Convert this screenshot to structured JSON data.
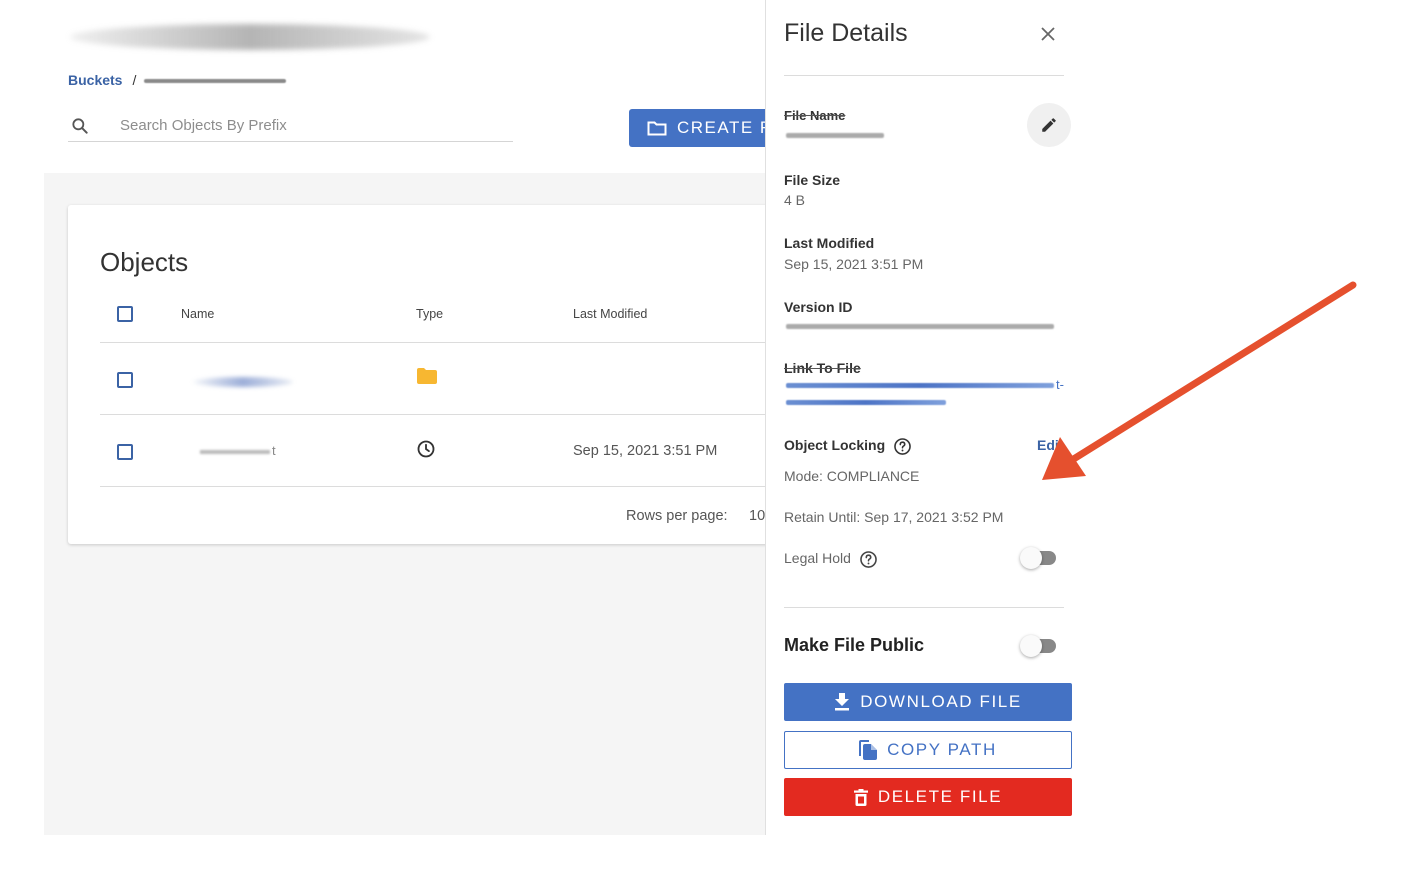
{
  "breadcrumb": {
    "root": "Buckets",
    "separator": "/"
  },
  "search": {
    "placeholder": "Search Objects By Prefix",
    "value": ""
  },
  "toolbar": {
    "create_label": "CREATE F"
  },
  "objects": {
    "title": "Objects",
    "columns": [
      "Name",
      "Type",
      "Last Modified"
    ],
    "rows": [
      {
        "name_suffix": "",
        "type_icon": "folder-icon",
        "last_modified": ""
      },
      {
        "name_suffix": "t",
        "type_icon": "clock-icon",
        "last_modified": "Sep 15, 2021 3:51 PM"
      }
    ],
    "rows_per_page_label": "Rows per page:",
    "rows_per_page_value": "10"
  },
  "details": {
    "title": "File Details",
    "file_name_label": "File Name",
    "file_size_label": "File Size",
    "file_size_value": "4 B",
    "last_modified_label": "Last Modified",
    "last_modified_value": "Sep 15, 2021 3:51 PM",
    "version_id_label": "Version ID",
    "link_label": "Link To File",
    "link_suffix": "t-",
    "object_locking_label": "Object Locking",
    "edit_label": "Edit",
    "mode_text": "Mode: COMPLIANCE",
    "retain_text": "Retain Until: Sep 17, 2021 3:52 PM",
    "legal_hold_label": "Legal Hold",
    "legal_hold_on": false,
    "make_public_label": "Make File Public",
    "make_public_on": false,
    "download_label": "DOWNLOAD FILE",
    "copy_label": "COPY PATH",
    "delete_label": "DELETE FILE"
  },
  "colors": {
    "primary": "#4472c4",
    "link": "#3b63a5",
    "danger": "#e32a20",
    "folder": "#f7b731",
    "annotation_arrow": "#e5502e"
  }
}
